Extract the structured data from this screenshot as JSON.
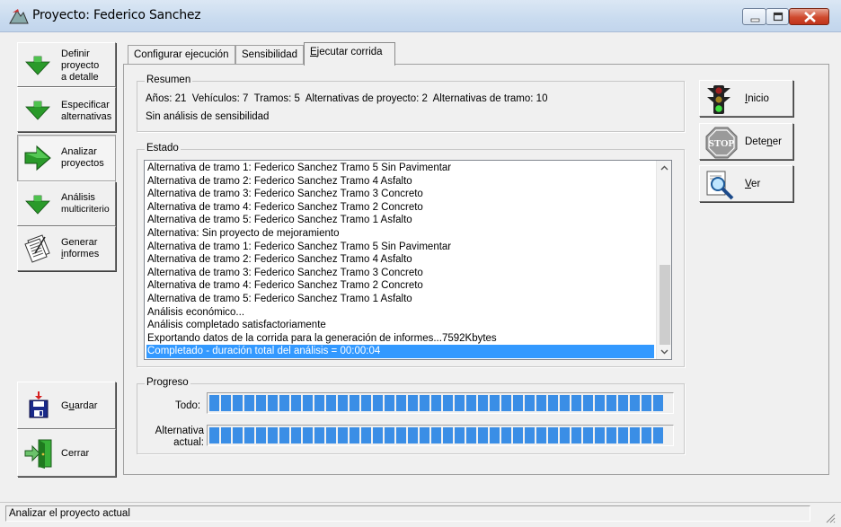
{
  "window": {
    "title": "Proyecto: Federico Sanchez"
  },
  "nav": {
    "items": [
      {
        "lines": [
          "Definir",
          "proyecto",
          "a detalle"
        ],
        "icon": "green-down-arrow-icon"
      },
      {
        "lines": [
          "Especificar",
          "alternativas"
        ],
        "icon": "green-down-arrow-icon"
      },
      {
        "lines": [
          "Analizar",
          "proyectos"
        ],
        "icon": "green-right-arrow-icon"
      },
      {
        "lines": [
          "Análisis",
          "multicriterio"
        ],
        "icon": "green-down-arrow-icon"
      },
      {
        "lines": [
          "Generar",
          "informes"
        ],
        "icon": "reports-icon"
      }
    ],
    "save_label": "Guardar",
    "close_label": "Cerrar"
  },
  "tabs": [
    {
      "label": "Configurar ejecución"
    },
    {
      "label": "Sensibilidad"
    },
    {
      "label": "Ejecutar corrida"
    }
  ],
  "summary": {
    "title": "Resumen",
    "line1": "Años: 21  Vehículos: 7  Tramos: 5  Alternativas de proyecto: 2  Alternativas de tramo: 10",
    "line2": "Sin análisis de sensibilidad"
  },
  "state": {
    "title": "Estado",
    "rows": [
      "Alternativa de tramo 1: Federico Sanchez Tramo 5 Sin Pavimentar",
      "Alternativa de tramo 2: Federico Sanchez Tramo 4 Asfalto",
      "Alternativa de tramo 3: Federico Sanchez Tramo 3 Concreto",
      "Alternativa de tramo 4: Federico Sanchez Tramo 2 Concreto",
      "Alternativa de tramo 5: Federico Sanchez Tramo 1 Asfalto",
      "Alternativa: Sin proyecto de mejoramiento",
      "Alternativa de tramo 1: Federico Sanchez Tramo 5 Sin Pavimentar",
      "Alternativa de tramo 2: Federico Sanchez Tramo 4 Asfalto",
      "Alternativa de tramo 3: Federico Sanchez Tramo 3 Concreto",
      "Alternativa de tramo 4: Federico Sanchez Tramo 2 Concreto",
      "Alternativa de tramo 5: Federico Sanchez Tramo 1 Asfalto",
      "Análisis económico...",
      "Análisis completado satisfactoriamente",
      "Exportando datos de la corrida para la generación de informes...7592Kbytes",
      "Completado - duración total del análisis = 00:00:04"
    ],
    "selected_index": 14
  },
  "progress": {
    "title": "Progreso",
    "all_label": "Todo:",
    "current_label_1": "Alternativa",
    "current_label_2": "actual:",
    "all_value": 1.0,
    "current_value": 1.0
  },
  "actions": {
    "start_label": "Inicio",
    "stop_label": "Detener",
    "view_label": "Ver",
    "stop_sign_text": "STOP"
  },
  "statusbar": {
    "text": "Analizar el proyecto actual"
  },
  "colors": {
    "selection": "#3399ff",
    "progress": "#3a8ee6"
  }
}
